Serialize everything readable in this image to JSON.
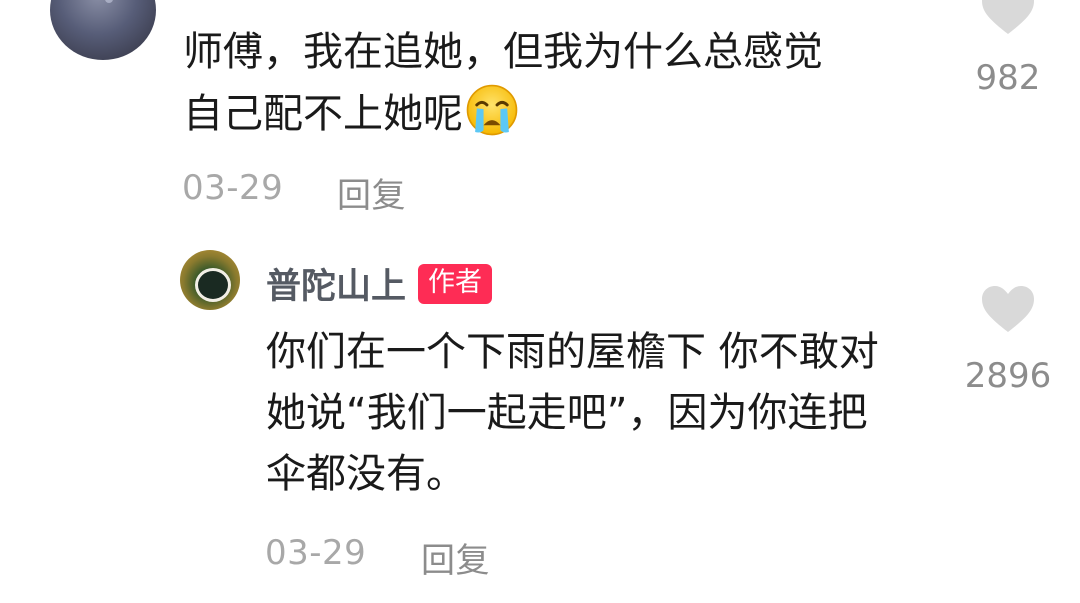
{
  "comment": {
    "text_line1": "师傅，我在追她，但我为什么总感觉",
    "text_line2": "自己配不上她呢",
    "emoji_icon": "crying-face-emoji",
    "date": "03-29",
    "reply_label": "回复",
    "like_count": "982",
    "like_icon": "heart-icon"
  },
  "reply": {
    "username": "普陀山上",
    "badge": "作者",
    "text_line1": "你们在一个下雨的屋檐下 你不敢对",
    "text_line2": "她说“我们一起走吧”，因为你连把",
    "text_line3": "伞都没有。",
    "date": "03-29",
    "reply_label": "回复",
    "like_count": "2896",
    "like_icon": "heart-icon"
  },
  "colors": {
    "badge_bg": "#fe2c55",
    "meta_text": "#a8a8a8",
    "heart": "#d9d9d9"
  }
}
